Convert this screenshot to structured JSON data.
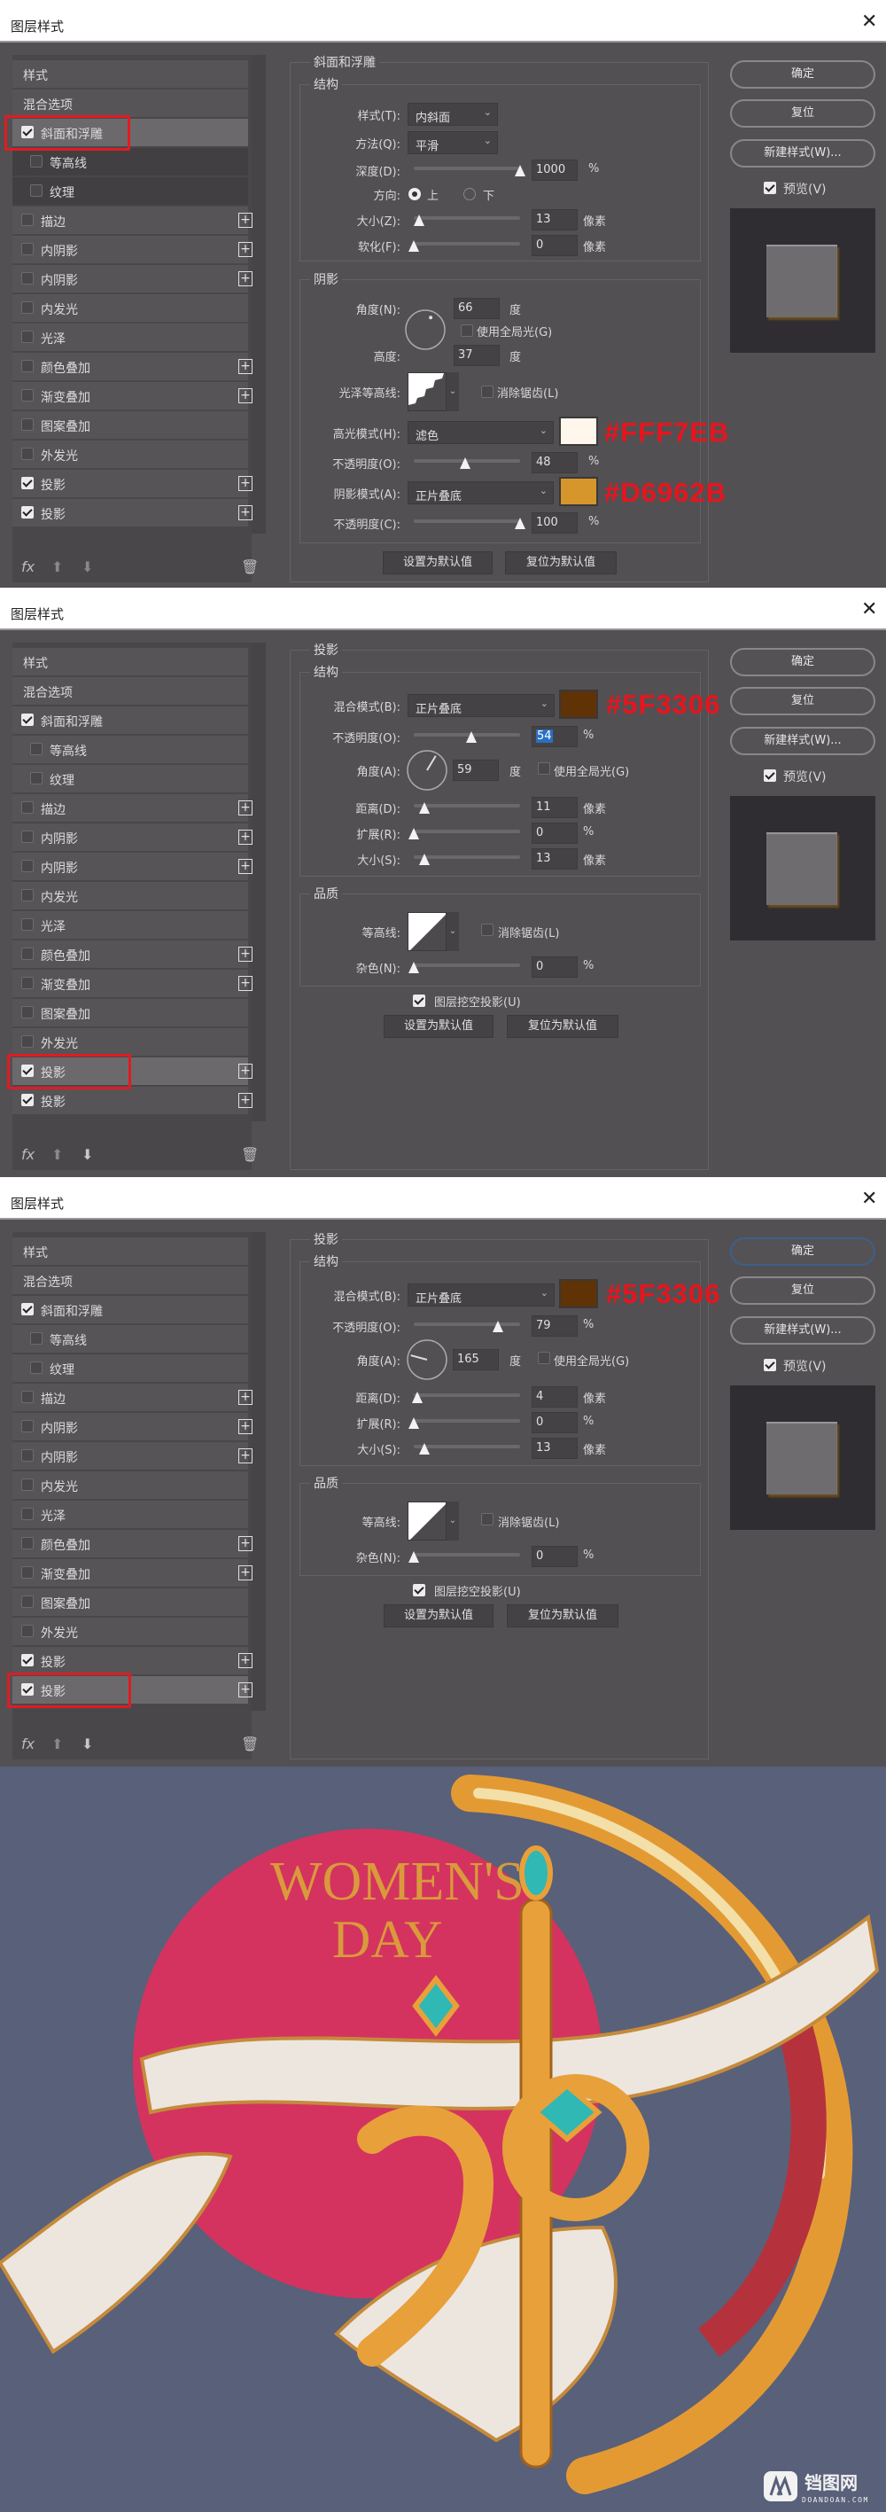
{
  "dialog_title": "图层样式",
  "close_icon": "close-icon",
  "right_buttons": {
    "ok": "确定",
    "reset": "复位",
    "new_style": "新建样式(W)...",
    "preview": "预览(V)"
  },
  "footer": {
    "fx": "fx",
    "icons": [
      "fx-icon",
      "arrow-up-icon",
      "arrow-down-icon",
      "trash-icon"
    ]
  },
  "list_items": [
    "样式",
    "混合选项",
    "斜面和浮雕",
    "等高线",
    "纹理",
    "描边",
    "内阴影",
    "内阴影",
    "内发光",
    "光泽",
    "颜色叠加",
    "渐变叠加",
    "图案叠加",
    "外发光",
    "投影",
    "投影"
  ],
  "annotation_color": "#E8141E",
  "panels": [
    {
      "selected_item": 2,
      "checked_items": [
        2,
        14,
        15
      ],
      "bevel": {
        "group_title": "斜面和浮雕",
        "structure_title": "结构",
        "style_label": "样式(T):",
        "style_value": "内斜面",
        "technique_label": "方法(Q):",
        "technique_value": "平滑",
        "depth_label": "深度(D):",
        "depth_value": "1000",
        "depth_unit": "%",
        "depth_level": 1.0,
        "direction_label": "方向:",
        "direction_up": "上",
        "direction_down": "下",
        "direction_selected": "上",
        "size_label": "大小(Z):",
        "size_value": "13",
        "size_unit": "像素",
        "size_level": 0.05,
        "soften_label": "软化(F):",
        "soften_value": "0",
        "soften_unit": "像素",
        "soften_level": 0,
        "shading_title": "阴影",
        "angle_label": "角度(N):",
        "angle_value": "66",
        "angle_unit": "度",
        "angle_dot": 66,
        "global_light_label": "使用全局光(G)",
        "global_light_checked": false,
        "altitude_label": "高度:",
        "altitude_value": "37",
        "altitude_unit": "度",
        "gloss_contour_label": "光泽等高线:",
        "anti_alias_label": "消除锯齿(L)",
        "anti_alias_checked": false,
        "highlight_mode_label": "高光模式(H):",
        "highlight_mode_value": "滤色",
        "highlight_color": "#FFF7EB",
        "highlight_annotation": "#FFF7EB",
        "highlight_opacity_label": "不透明度(O):",
        "highlight_opacity_value": "48",
        "highlight_opacity_unit": "%",
        "highlight_opacity_level": 0.48,
        "shadow_mode_label": "阴影模式(A):",
        "shadow_mode_value": "正片叠底",
        "shadow_color": "#D6962B",
        "shadow_annotation": "#D6962B",
        "shadow_opacity_label": "不透明度(C):",
        "shadow_opacity_value": "100",
        "shadow_opacity_unit": "%",
        "shadow_opacity_level": 1.0,
        "make_default": "设置为默认值",
        "reset_default": "复位为默认值"
      }
    },
    {
      "selected_item": 14,
      "checked_items": [
        2,
        14,
        15
      ],
      "ok_focused": false,
      "shadow": {
        "group_title": "投影",
        "structure_title": "结构",
        "blend_label": "混合模式(B):",
        "blend_value": "正片叠底",
        "color": "#5F3306",
        "annotation": "#5F3306",
        "opacity_label": "不透明度(O):",
        "opacity_value": "54",
        "opacity_unit": "%",
        "opacity_level": 0.54,
        "opacity_selected": true,
        "angle_label": "角度(A):",
        "angle_value": "59",
        "angle_unit": "度",
        "global_light_label": "使用全局光(G)",
        "global_light_checked": false,
        "distance_label": "距离(D):",
        "distance_value": "11",
        "distance_unit": "像素",
        "distance_level": 0.1,
        "spread_label": "扩展(R):",
        "spread_value": "0",
        "spread_unit": "%",
        "spread_level": 0,
        "size_label": "大小(S):",
        "size_value": "13",
        "size_unit": "像素",
        "size_level": 0.1,
        "quality_title": "品质",
        "contour_label": "等高线:",
        "anti_alias_label": "消除锯齿(L)",
        "anti_alias_checked": false,
        "noise_label": "杂色(N):",
        "noise_value": "0",
        "noise_unit": "%",
        "noise_level": 0,
        "knockout_label": "图层挖空投影(U)",
        "knockout_checked": true,
        "make_default": "设置为默认值",
        "reset_default": "复位为默认值"
      }
    },
    {
      "selected_item": 15,
      "checked_items": [
        2,
        14,
        15
      ],
      "ok_focused": true,
      "shadow": {
        "group_title": "投影",
        "structure_title": "结构",
        "blend_label": "混合模式(B):",
        "blend_value": "正片叠底",
        "color": "#5F3306",
        "annotation": "#5F3306",
        "opacity_label": "不透明度(O):",
        "opacity_value": "79",
        "opacity_unit": "%",
        "opacity_level": 0.79,
        "opacity_selected": false,
        "angle_label": "角度(A):",
        "angle_value": "165",
        "angle_unit": "度",
        "global_light_label": "使用全局光(G)",
        "global_light_checked": false,
        "distance_label": "距离(D):",
        "distance_value": "4",
        "distance_unit": "像素",
        "distance_level": 0.03,
        "spread_label": "扩展(R):",
        "spread_value": "0",
        "spread_unit": "%",
        "spread_level": 0,
        "size_label": "大小(S):",
        "size_value": "13",
        "size_unit": "像素",
        "size_level": 0.1,
        "quality_title": "品质",
        "contour_label": "等高线:",
        "anti_alias_label": "消除锯齿(L)",
        "anti_alias_checked": false,
        "noise_label": "杂色(N):",
        "noise_value": "0",
        "noise_unit": "%",
        "noise_level": 0,
        "knockout_label": "图层挖空投影(U)",
        "knockout_checked": true,
        "make_default": "设置为默认值",
        "reset_default": "复位为默认值"
      }
    }
  ],
  "artwork": {
    "headline_line1": "WOMEN'S",
    "headline_line2": "DAY",
    "background_color": "#596079",
    "circle_color": "#D4335F",
    "gold_color": "#E3A03A",
    "gem_color": "#2FB8B4",
    "watermark_name": "铛图网",
    "watermark_url": "DOANDOAN.COM"
  }
}
